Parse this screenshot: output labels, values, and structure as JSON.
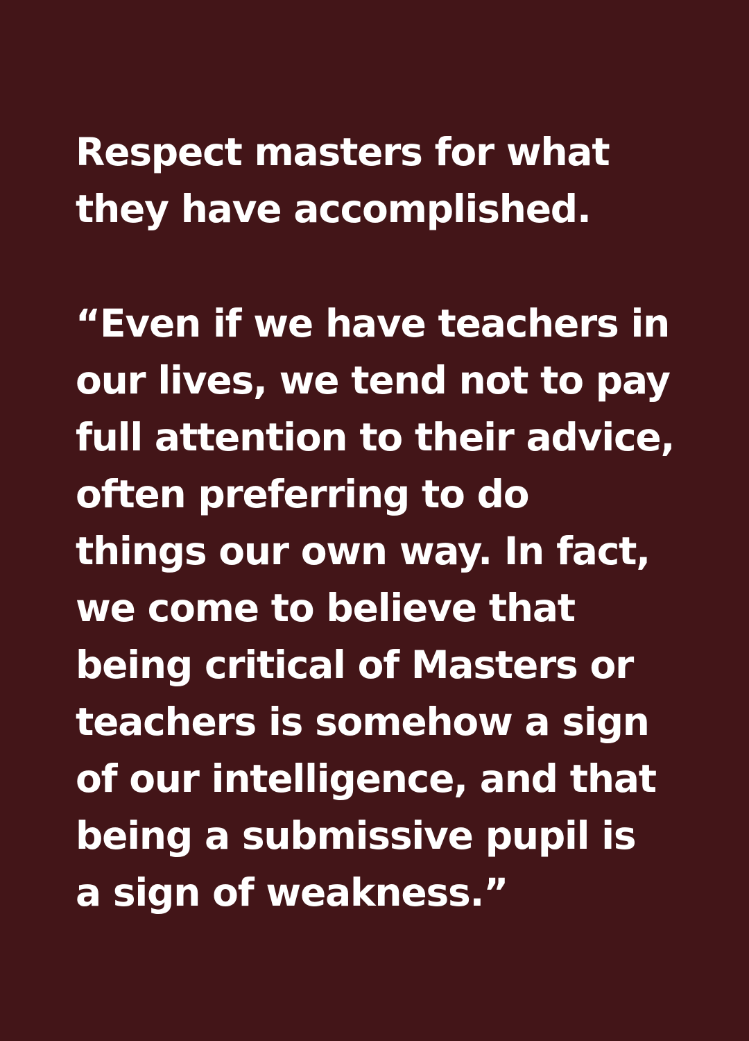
{
  "colors": {
    "background": "#431518",
    "text": "#ffffff"
  },
  "heading": {
    "lines": [
      "Respect masters for what",
      "they have accomplished."
    ]
  },
  "quote": {
    "lines": [
      "“Even if we have teachers in",
      "our lives, we tend not to pay",
      "full attention to their advice,",
      "often preferring to do",
      "things our own way. In fact,",
      "we come to believe that",
      "being critical of Masters or",
      "teachers is somehow a sign",
      "of our intelligence, and that",
      "being a submissive pupil is",
      "a sign of weakness.”"
    ]
  }
}
